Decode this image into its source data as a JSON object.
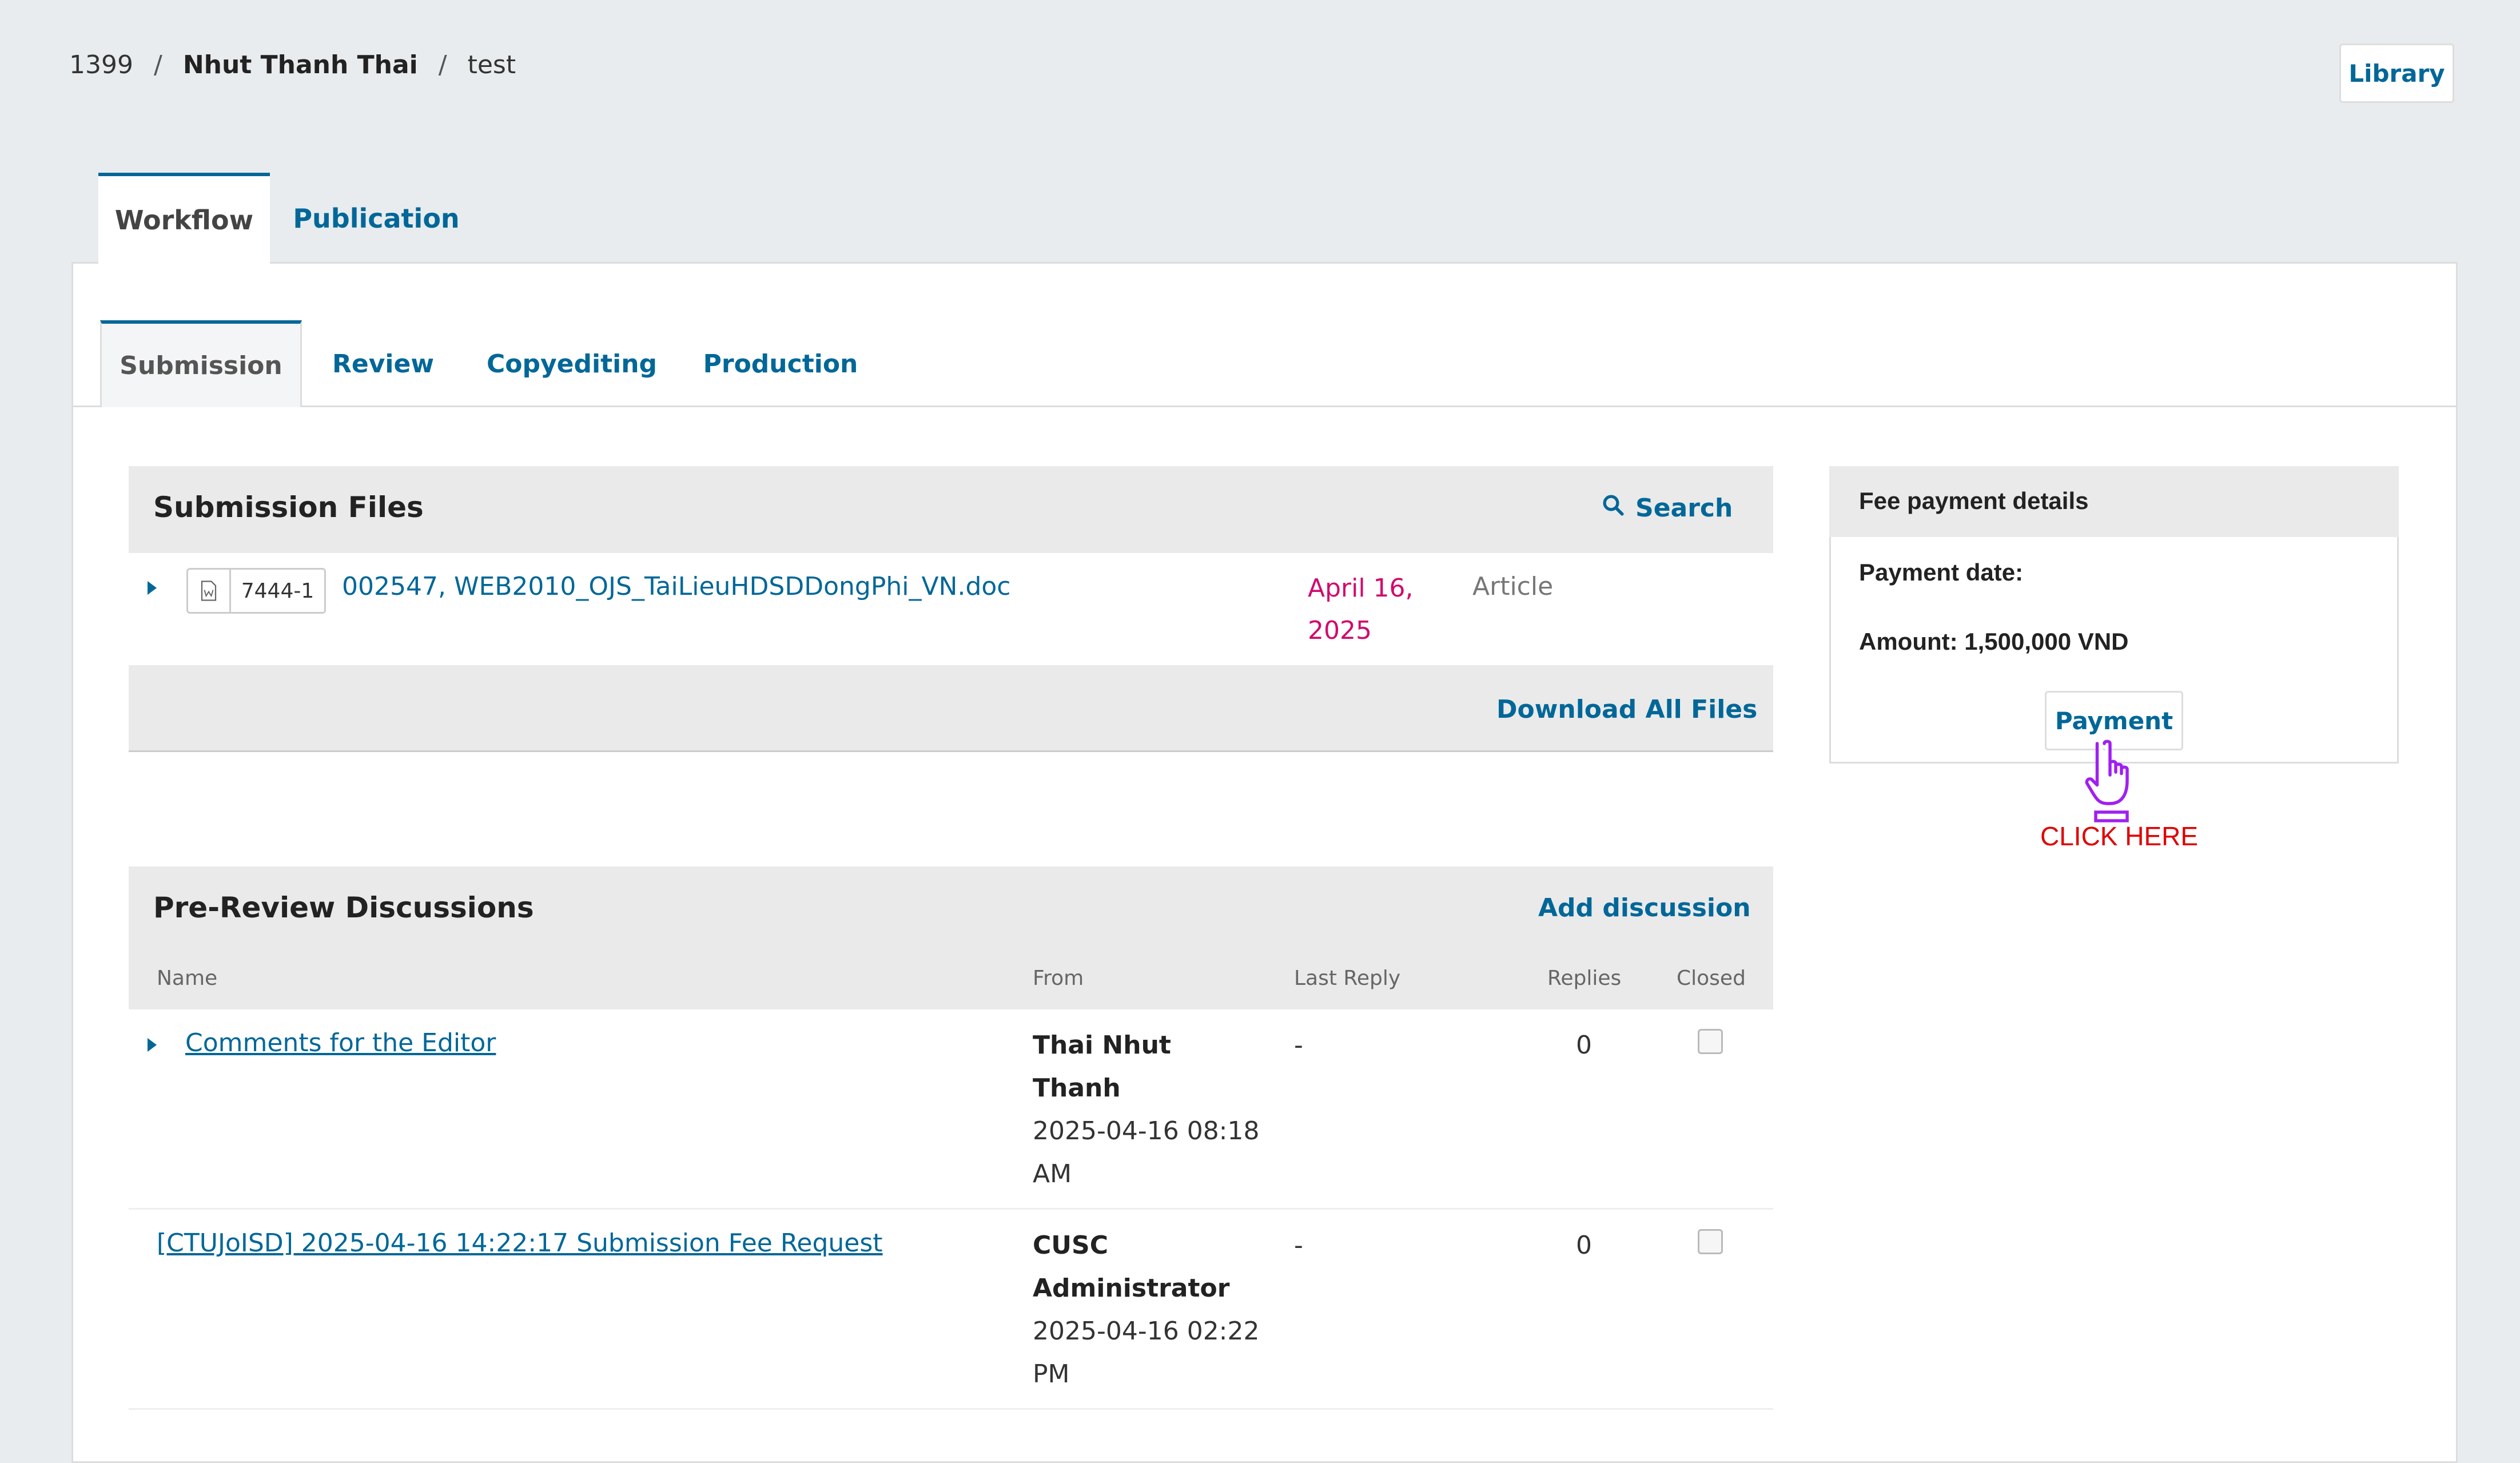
{
  "breadcrumb": {
    "id": "1399",
    "author": "Nhut Thanh Thai",
    "title": "test",
    "sep": "/"
  },
  "library_button": "Library",
  "top_tabs": [
    "Workflow",
    "Publication"
  ],
  "stage_tabs": [
    "Submission",
    "Review",
    "Copyediting",
    "Production"
  ],
  "submission_files": {
    "title": "Submission Files",
    "search_label": "Search",
    "files": [
      {
        "id": "7444-1",
        "name": "002547, WEB2010_OJS_TaiLieuHDSDDongPhi_VN.doc",
        "date_line1": "April 16,",
        "date_line2": "2025",
        "type": "Article"
      }
    ],
    "download_all": "Download All Files"
  },
  "discussions": {
    "title": "Pre-Review Discussions",
    "add_label": "Add discussion",
    "columns": {
      "name": "Name",
      "from": "From",
      "last_reply": "Last Reply",
      "replies": "Replies",
      "closed": "Closed"
    },
    "rows": [
      {
        "name": "Comments for the Editor",
        "from_line1": "Thai Nhut",
        "from_line2": "Thanh",
        "date_line1": "2025-04-16 08:18",
        "date_line2": "AM",
        "last_reply": "-",
        "replies": "0"
      },
      {
        "name": "[CTUJoISD] 2025-04-16 14:22:17 Submission Fee Request",
        "from_line1": "CUSC",
        "from_line2": "Administrator",
        "date_line1": "2025-04-16 02:22",
        "date_line2": "PM",
        "last_reply": "-",
        "replies": "0"
      }
    ]
  },
  "fee": {
    "title": "Fee payment details",
    "payment_date_label": "Payment date:",
    "amount_label": "Amount: 1,500,000 VND",
    "payment_button": "Payment",
    "annotation": "CLICK HERE"
  },
  "colors": {
    "accent": "#006798",
    "date": "#d00a6c",
    "annotation": "#e00000",
    "hand": "#a020f0"
  }
}
